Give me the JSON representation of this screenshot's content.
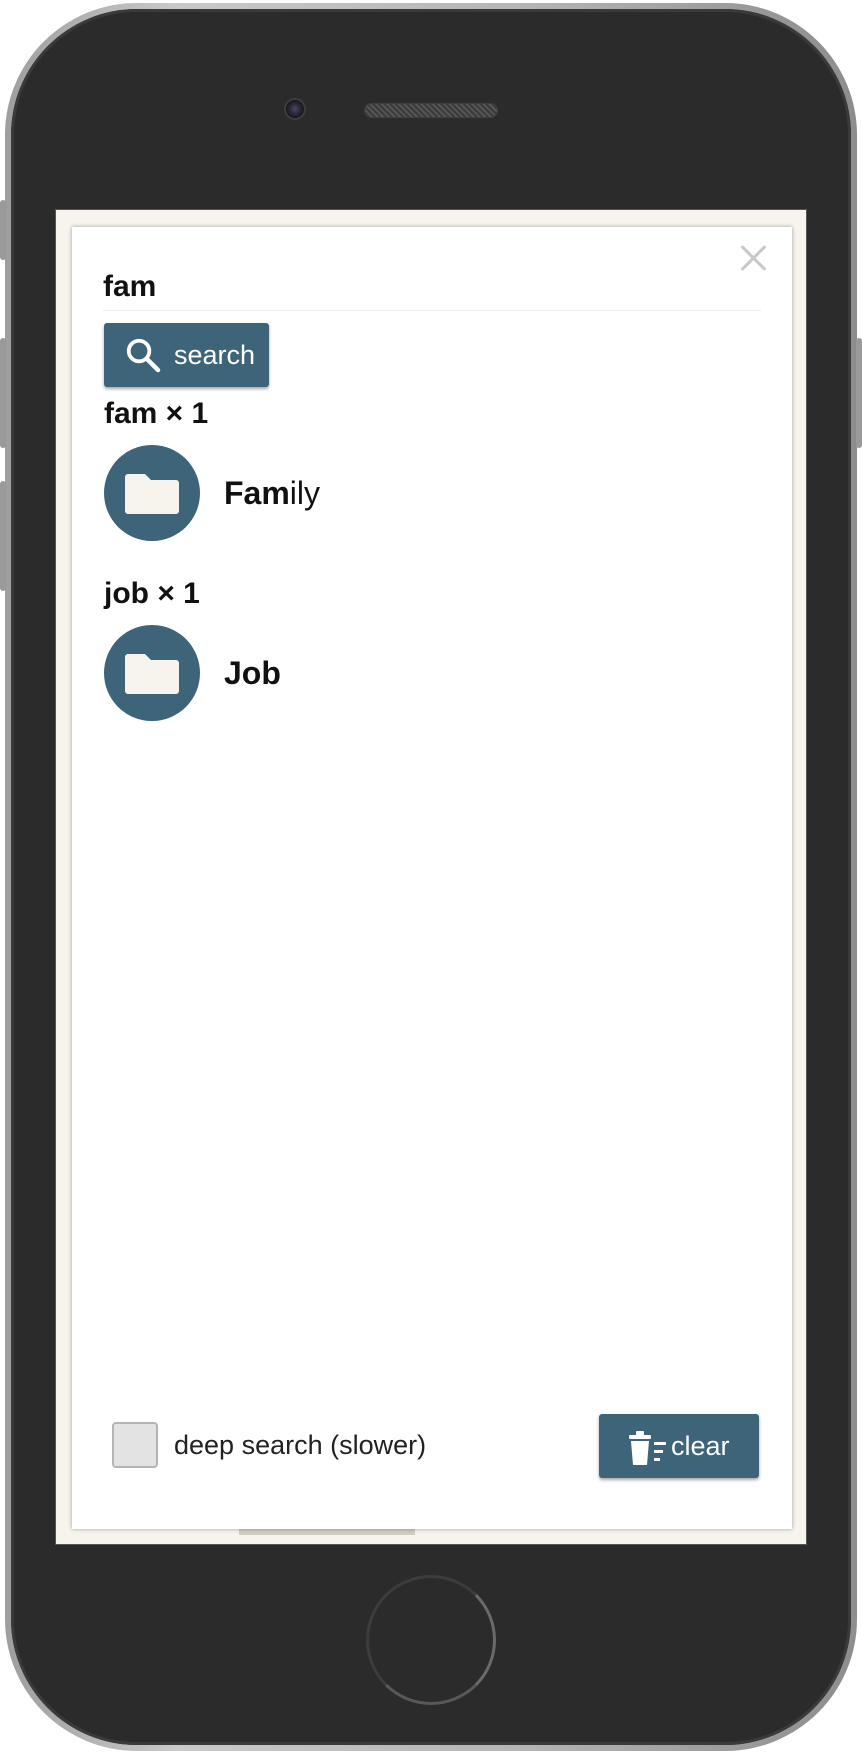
{
  "search": {
    "query": "fam",
    "button_label": "search"
  },
  "results": [
    {
      "heading": "fam × 1",
      "items": [
        {
          "match": "Fam",
          "rest": "ily",
          "icon": "folder-icon"
        }
      ]
    },
    {
      "heading": "job × 1",
      "items": [
        {
          "match": "Job",
          "rest": "",
          "icon": "folder-icon"
        }
      ]
    }
  ],
  "footer": {
    "deep_search_label": "deep search (slower)",
    "deep_search_checked": false,
    "clear_label": "clear"
  },
  "colors": {
    "accent": "#3d6479",
    "folder_fill": "#f6f4ec",
    "screen_background": "#f6f4ec",
    "phone_body": "#2b2b2b"
  }
}
